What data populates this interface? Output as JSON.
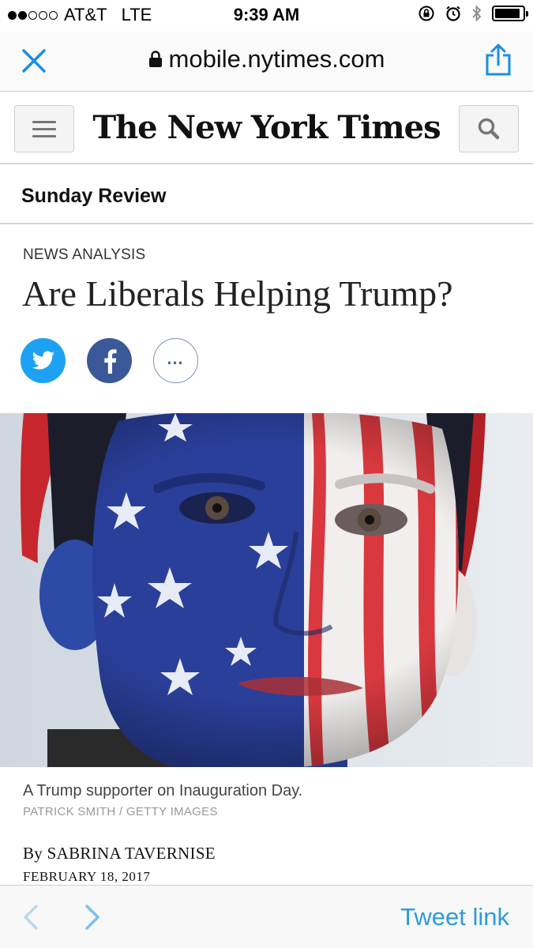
{
  "status_bar": {
    "carrier": "AT&T",
    "network": "LTE",
    "time": "9:39 AM",
    "signal_bars_filled": 2,
    "signal_bars_total": 5,
    "battery_level": 0.92
  },
  "browser": {
    "url": "mobile.nytimes.com",
    "close_icon": "close-icon",
    "share_icon": "share-icon",
    "lock_icon": "lock-icon"
  },
  "site_header": {
    "logo_text": "The New York Times",
    "menu_icon": "hamburger-menu-icon",
    "search_icon": "search-icon"
  },
  "section": {
    "title": "Sunday Review"
  },
  "article": {
    "kicker": "NEWS ANALYSIS",
    "headline": "Are Liberals Helping Trump?",
    "share_buttons": [
      "twitter-icon",
      "facebook-icon",
      "more-icon"
    ],
    "more_label": "…",
    "photo_caption": "A Trump supporter on Inauguration Day.",
    "photo_credit": "PATRICK SMITH / GETTY IMAGES",
    "byline": "By SABRINA TAVERNISE",
    "date": "FEBRUARY 18, 2017"
  },
  "toolbar": {
    "back_icon": "chevron-left-icon",
    "forward_icon": "chevron-right-icon",
    "tweet_link_label": "Tweet link"
  },
  "colors": {
    "twitter": "#1da1f2",
    "facebook": "#3b5998",
    "link_blue": "#2d9cdb",
    "flag_blue": "#2a3f9a",
    "flag_red": "#d9383f"
  }
}
